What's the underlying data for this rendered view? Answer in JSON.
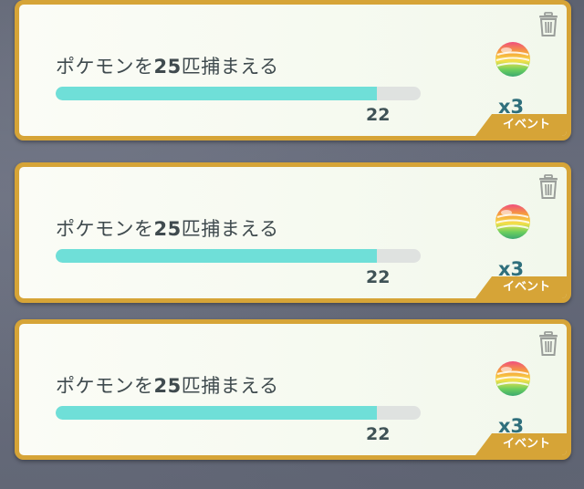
{
  "event_label": "イベント",
  "tasks": [
    {
      "title_prefix": "ポケモンを",
      "title_number": "25",
      "title_suffix": "匹捕まえる",
      "progress_value": "22",
      "progress_fraction": 0.88,
      "reward_icon": "rainbow-candy-icon",
      "reward_quantity": "x3"
    },
    {
      "title_prefix": "ポケモンを",
      "title_number": "25",
      "title_suffix": "匹捕まえる",
      "progress_value": "22",
      "progress_fraction": 0.88,
      "reward_icon": "rainbow-candy-icon",
      "reward_quantity": "x3"
    },
    {
      "title_prefix": "ポケモンを",
      "title_number": "25",
      "title_suffix": "匹捕まえる",
      "progress_value": "22",
      "progress_fraction": 0.88,
      "reward_icon": "rainbow-candy-icon",
      "reward_quantity": "x3"
    }
  ],
  "colors": {
    "card_border": "#d6a437",
    "progress_fill": "#6fdfd8",
    "progress_track": "#dfe2e0",
    "quantity_text": "#2f6f7c"
  }
}
